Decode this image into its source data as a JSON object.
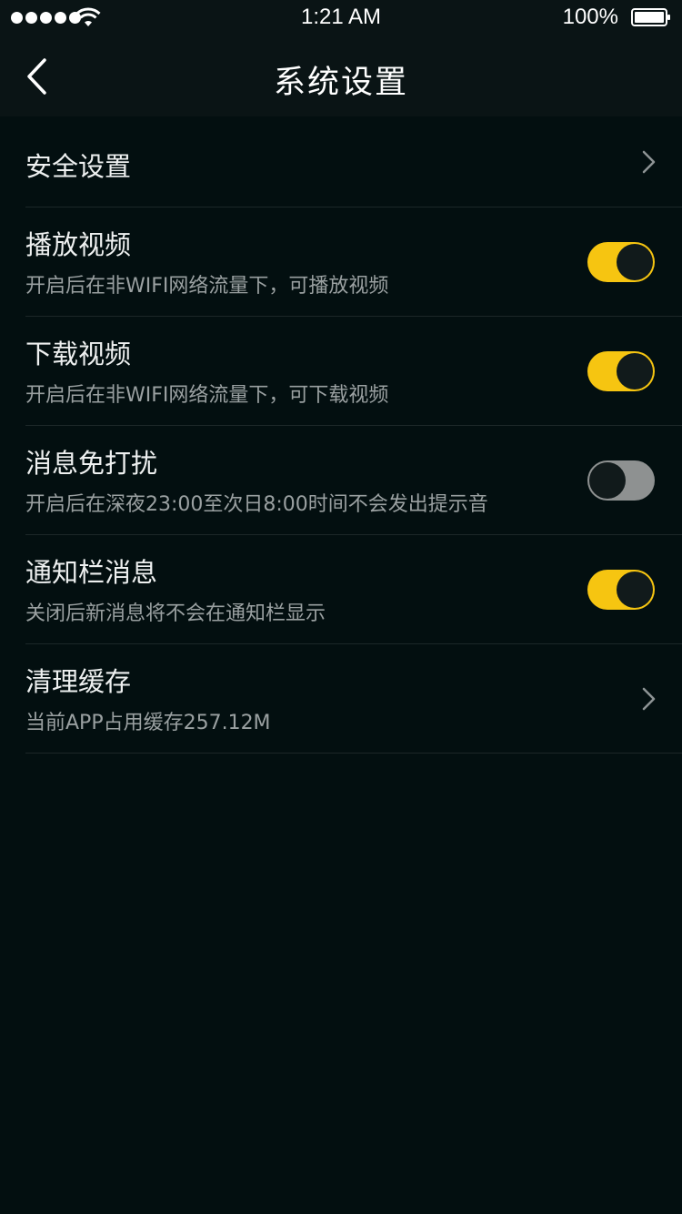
{
  "status_bar": {
    "time": "1:21 AM",
    "battery_percent": "100%",
    "signal_icon": "signal-dots-icon",
    "wifi_icon": "wifi-icon",
    "battery_icon": "battery-icon"
  },
  "nav": {
    "title": "系统设置",
    "back_icon": "chevron-left-icon"
  },
  "colors": {
    "background": "#030f10",
    "toggle_on": "#f6c511",
    "toggle_off": "#8e9191"
  },
  "settings": {
    "security": {
      "title": "安全设置"
    },
    "play_video": {
      "title": "播放视频",
      "subtitle": "开启后在非WIFI网络流量下，可播放视频",
      "enabled": true
    },
    "download_video": {
      "title": "下载视频",
      "subtitle": "开启后在非WIFI网络流量下，可下载视频",
      "enabled": true
    },
    "do_not_disturb": {
      "title": "消息免打扰",
      "subtitle": "开启后在深夜23:00至次日8:00时间不会发出提示音",
      "enabled": false
    },
    "notification_bar": {
      "title": "通知栏消息",
      "subtitle": "关闭后新消息将不会在通知栏显示",
      "enabled": true
    },
    "clear_cache": {
      "title": "清理缓存",
      "subtitle": "当前APP占用缓存257.12M"
    }
  }
}
